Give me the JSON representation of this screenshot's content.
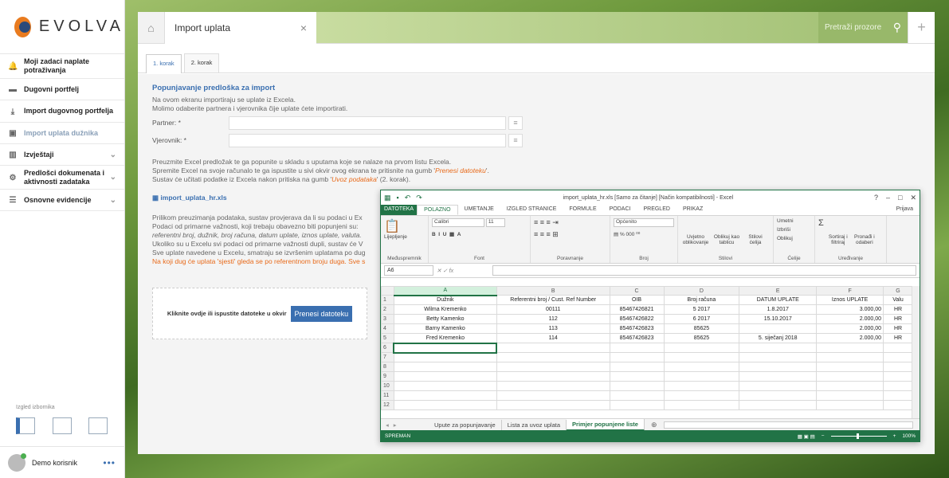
{
  "brand": {
    "name": "EVOLVA"
  },
  "sidebar": {
    "items": [
      {
        "label": "Moji zadaci naplate potraživanja",
        "icon": "bell-icon"
      },
      {
        "label": "Dugovni portfelj",
        "icon": "briefcase-icon"
      },
      {
        "label": "Import dugovnog portfelja",
        "icon": "upload-icon"
      },
      {
        "label": "Import uplata dužnika",
        "icon": "money-icon"
      },
      {
        "label": "Izvještaji",
        "icon": "bar-chart-icon"
      },
      {
        "label": "Predlošci dokumenata i aktivnosti zadataka",
        "icon": "gear-icon"
      },
      {
        "label": "Osnovne evidencije",
        "icon": "list-icon"
      }
    ],
    "layout_label": "Izgled izbornika",
    "user": "Demo korisnik"
  },
  "tab": {
    "title": "Import uplata",
    "close": "×",
    "search_placeholder": "Pretraži prozore"
  },
  "steps": [
    "1. korak",
    "2. korak"
  ],
  "form": {
    "title": "Popunjavanje predloška za import",
    "intro1": "Na ovom ekranu importiraju se uplate iz Excela.",
    "intro2": "Molimo odaberite partnera i vjerovnika čije uplate ćete importirati.",
    "partner_label": "Partner: *",
    "creditor_label": "Vjerovnik: *",
    "info1": "Preuzmite Excel predložak te ga popunite u skladu s uputama koje se nalaze na prvom listu Excela.",
    "info2a": "Spremite Excel na svoje računalo te ga ispustite u sivi okvir ovog ekrana te pritisnite na gumb '",
    "info2b": "Prenesi datoteku",
    "info2c": "'.",
    "info3a": "Sustav će učitati podatke iz Excela nakon pritiska na gumb '",
    "info3b": "Uvoz podataka",
    "info3c": "' (2. korak).",
    "file_link": "import_uplata_hr.xls",
    "p1": "Prilikom preuzimanja podataka, sustav provjerava da li su podaci u Ex",
    "p2": "Podaci od primarne važnosti, koji trebaju obavezno biti popunjeni su:",
    "p3": "referentni broj, dužnik, broj računa, datum uplate, iznos uplate, valuta.",
    "p4": "Ukoliko su u Excelu svi podaci od primarne važnosti dupli, sustav će V",
    "p5": "Sve uplate navedene u Excelu, smatraju se izvršenim uplatama po dug",
    "p6": "Na koji dug će uplata 'sjesti' gleda se po referentnom broju duga. Sve s",
    "drop_text": "Kliknite ovdje ili ispustite datoteke u okvir",
    "upload_button": "Prenesi datoteku"
  },
  "excel": {
    "title": "import_uplata_hr.xls  [Samo za čitanje]  [Način kompatibilnosti] - Excel",
    "menu": [
      "DATOTEKA",
      "POLAZNO",
      "UMETANJE",
      "IZGLED STRANICE",
      "FORMULE",
      "PODACI",
      "PREGLED",
      "PRIKAZ"
    ],
    "signin": "Prijava",
    "ribbon": {
      "paste": "Lijepljenje",
      "clipboard": "Međuspremnik",
      "font_name": "Calibri",
      "font_size": "11",
      "font": "Font",
      "alignment": "Poravnanje",
      "number_format": "Općenito",
      "number": "Broj",
      "cond": "Uvjetno oblikovanje",
      "astable": "Oblikuj kao tablicu",
      "cellstyles": "Stilovi ćelija",
      "styles": "Stilovi",
      "insert": "Umetni",
      "delete": "Izbriši",
      "format": "Oblikuj",
      "cells": "Ćelije",
      "sort": "Sortiraj i filtriraj",
      "find": "Pronađi i odaberi",
      "editing": "Uređivanje"
    },
    "namebox": "A6",
    "columns": [
      "A",
      "B",
      "C",
      "D",
      "E",
      "F",
      "G"
    ],
    "rows": [
      [
        "Dužnik",
        "Referentni broj / Cust. Ref Number",
        "OIB",
        "Broj računa",
        "DATUM UPLATE",
        "Iznos UPLATE",
        "Valu"
      ],
      [
        "Wilma Kremenko",
        "00111",
        "85467426821",
        "5 2017",
        "1.8.2017",
        "3.000,00",
        "HR"
      ],
      [
        "Betty Kamenko",
        "112",
        "85467426822",
        "6 2017",
        "15.10.2017",
        "2.000,00",
        "HR"
      ],
      [
        "Barny Kamenko",
        "113",
        "85467426823",
        "85625",
        "",
        "2.000,00",
        "HR"
      ],
      [
        "Fred Kremenko",
        "114",
        "85467426823",
        "85625",
        "5. siječanj 2018",
        "2.000,00",
        "HR"
      ],
      [
        "",
        "",
        "",
        "",
        "",
        "",
        ""
      ],
      [
        "",
        "",
        "",
        "",
        "",
        "",
        ""
      ],
      [
        "",
        "",
        "",
        "",
        "",
        "",
        ""
      ],
      [
        "",
        "",
        "",
        "",
        "",
        "",
        ""
      ],
      [
        "",
        "",
        "",
        "",
        "",
        "",
        ""
      ],
      [
        "",
        "",
        "",
        "",
        "",
        "",
        ""
      ],
      [
        "",
        "",
        "",
        "",
        "",
        "",
        ""
      ]
    ],
    "sheets": [
      "Upute za popunjavanje",
      "Lista za uvoz uplata",
      "Primjer popunjene liste"
    ],
    "status": "SPREMAN",
    "zoom": "100%"
  }
}
